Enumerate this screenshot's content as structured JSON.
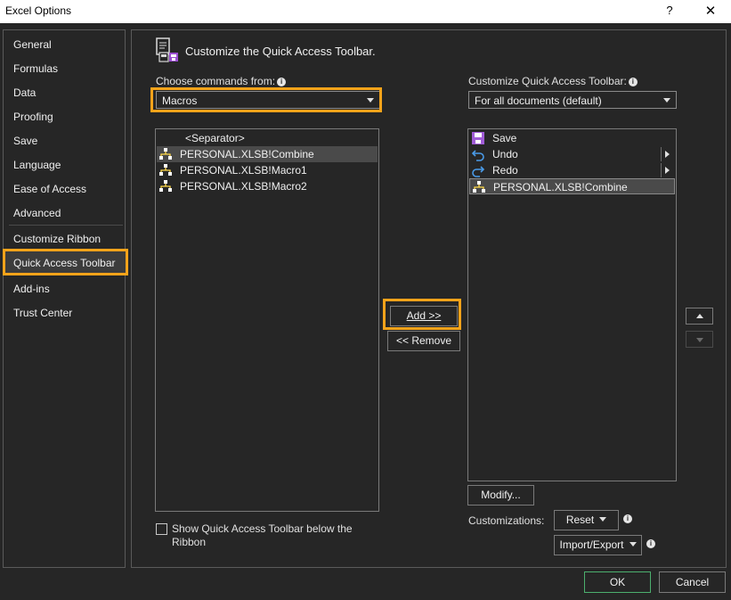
{
  "window": {
    "title": "Excel Options",
    "help_label": "?",
    "close_label": "✕"
  },
  "nav": {
    "items": [
      {
        "label": "General"
      },
      {
        "label": "Formulas"
      },
      {
        "label": "Data"
      },
      {
        "label": "Proofing"
      },
      {
        "label": "Save"
      },
      {
        "label": "Language"
      },
      {
        "label": "Ease of Access"
      },
      {
        "label": "Advanced"
      },
      {
        "label": "Customize Ribbon"
      },
      {
        "label": "Quick Access Toolbar"
      },
      {
        "label": "Add-ins"
      },
      {
        "label": "Trust Center"
      }
    ],
    "selected": "Quick Access Toolbar"
  },
  "main": {
    "heading": "Customize the Quick Access Toolbar.",
    "choose_label": "Choose commands from:",
    "choose_value": "Macros",
    "customize_label": "Customize Quick Access Toolbar:",
    "customize_value": "For all documents (default)",
    "commands": [
      {
        "label": "<Separator>",
        "icon": "none"
      },
      {
        "label": "PERSONAL.XLSB!Combine",
        "icon": "macro-icon"
      },
      {
        "label": "PERSONAL.XLSB!Macro1",
        "icon": "macro-icon"
      },
      {
        "label": "PERSONAL.XLSB!Macro2",
        "icon": "macro-icon"
      }
    ],
    "toolbar_items": [
      {
        "label": "Save",
        "icon": "save-icon"
      },
      {
        "label": "Undo",
        "icon": "undo-icon"
      },
      {
        "label": "Redo",
        "icon": "redo-icon"
      },
      {
        "label": "PERSONAL.XLSB!Combine",
        "icon": "macro-icon"
      }
    ],
    "add_label": "Add >>",
    "remove_label": "<< Remove",
    "modify_label": "Modify...",
    "customizations_label": "Customizations:",
    "reset_label": "Reset",
    "import_export_label": "Import/Export",
    "show_below_label": "Show Quick Access Toolbar below the",
    "show_below_label_2": "Ribbon"
  },
  "footer": {
    "ok_label": "OK",
    "cancel_label": "Cancel"
  },
  "colors": {
    "highlight": "#f5a31a",
    "background": "#262626",
    "ok_border": "#4caf6e"
  }
}
